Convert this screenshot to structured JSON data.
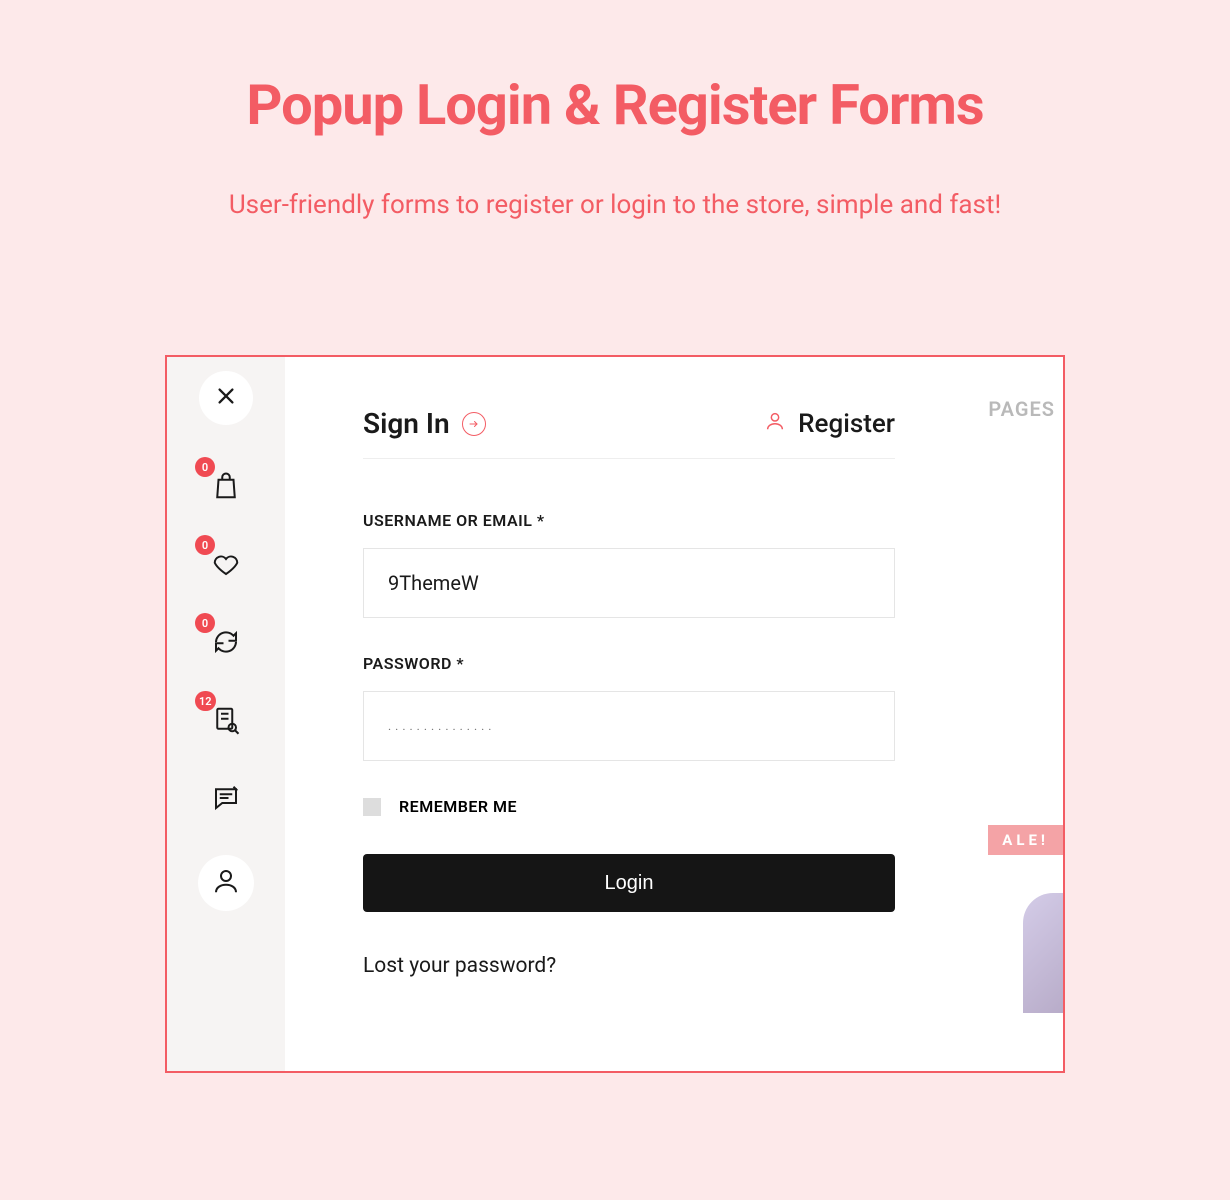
{
  "page": {
    "title": "Popup Login & Register Forms",
    "subtitle": "User-friendly forms to register or login to the store, simple and fast!"
  },
  "sidebar": {
    "badges": {
      "cart": "0",
      "wishlist": "0",
      "compare": "0",
      "orders": "12"
    }
  },
  "behind": {
    "nav_pages": "PAGES",
    "sale": "ALE!"
  },
  "form": {
    "signin_label": "Sign In",
    "register_label": "Register",
    "username_label": "USERNAME OR EMAIL *",
    "username_value": "9ThemeW",
    "password_label": "PASSWORD *",
    "password_value": "...............",
    "remember_label": "REMEMBER ME",
    "login_button": "Login",
    "lost_password": "Lost your password?"
  }
}
